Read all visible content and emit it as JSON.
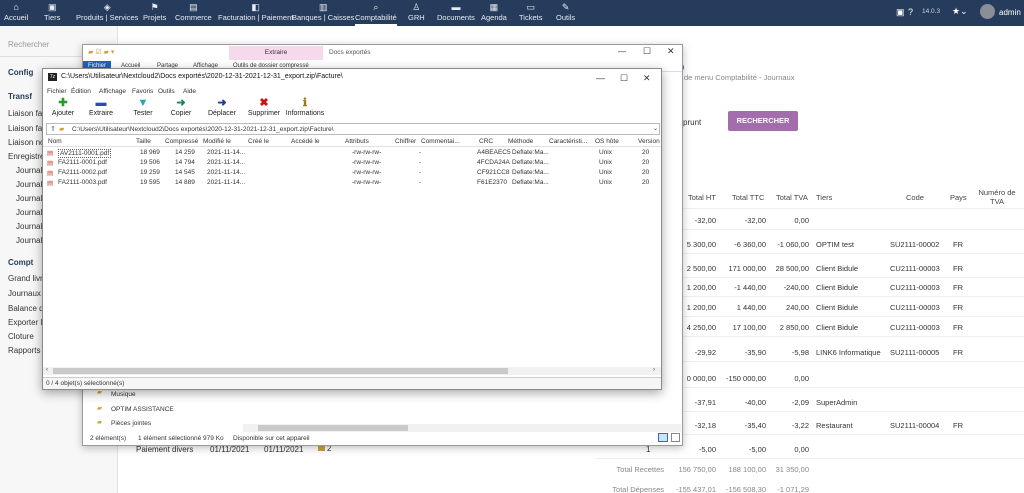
{
  "topbar": {
    "menu": [
      {
        "label": "Accueil",
        "icon": "⌂"
      },
      {
        "label": "Tiers",
        "icon": "▣"
      },
      {
        "label": "Produits | Services",
        "icon": "◈"
      },
      {
        "label": "Projets",
        "icon": "⚑"
      },
      {
        "label": "Commerce",
        "icon": "▤"
      },
      {
        "label": "Facturation | Paiement",
        "icon": "◧"
      },
      {
        "label": "Banques | Caisses",
        "icon": "▥"
      },
      {
        "label": "Comptabilité",
        "icon": "⌕"
      },
      {
        "label": "GRH",
        "icon": "♙"
      },
      {
        "label": "Documents",
        "icon": "▬"
      },
      {
        "label": "Agenda",
        "icon": "▦"
      },
      {
        "label": "Tickets",
        "icon": "▭"
      },
      {
        "label": "Outils",
        "icon": "✎"
      }
    ],
    "version": "14.0.3",
    "user": "admin"
  },
  "left": {
    "search_placeholder": "Rechercher",
    "items": [
      "Config",
      "Transf",
      "Liaison fa",
      "Liaison fa",
      "Liaison no",
      "Enregistre",
      "Journal",
      "Journal",
      "Journal",
      "Journal",
      "Journal",
      "Journal",
      "Compt",
      "Grand livr",
      "Journaux",
      "Balance d",
      "Exporter l",
      "Cloture",
      "Rapports"
    ]
  },
  "main": {
    "breadcrumb": "de menu Comptabilité - Journaux",
    "emprunt_label": "nt emprunt",
    "search_button": "RECHERCHER",
    "headers": {
      "total_ht": "Total HT",
      "total_ttc": "Total TTC",
      "total_tva": "Total TVA",
      "tiers": "Tiers",
      "code": "Code",
      "pays": "Pays",
      "num_tva": "Numéro de TVA"
    },
    "rows": [
      {
        "ht": "-32,00",
        "ttc": "-32,00",
        "tva": "0,00",
        "tiers": "",
        "code": "",
        "pays": ""
      },
      {
        "ht": "5 300,00",
        "ttc": "-6 360,00",
        "tva": "-1 060,00",
        "tiers": "OPTIM test",
        "code": "SU2111-00002",
        "pays": "FR"
      },
      {
        "ht": "2 500,00",
        "ttc": "171 000,00",
        "tva": "28 500,00",
        "tiers": "Client Bidule",
        "code": "CU2111-00003",
        "pays": "FR"
      },
      {
        "ht": "1 200,00",
        "ttc": "-1 440,00",
        "tva": "-240,00",
        "tiers": "Client Bidule",
        "code": "CU2111-00003",
        "pays": "FR"
      },
      {
        "ht": "1 200,00",
        "ttc": "1 440,00",
        "tva": "240,00",
        "tiers": "Client Bidule",
        "code": "CU2111-00003",
        "pays": "FR"
      },
      {
        "ht": "4 250,00",
        "ttc": "17 100,00",
        "tva": "2 850,00",
        "tiers": "Client Bidule",
        "code": "CU2111-00003",
        "pays": "FR"
      },
      {
        "ht": "-29,92",
        "ttc": "-35,90",
        "tva": "-5,98",
        "tiers": "LINK6 Informatique",
        "code": "SU2111-00005",
        "pays": "FR"
      },
      {
        "ht": "0 000,00",
        "ttc": "-150 000,00",
        "tva": "0,00",
        "tiers": "",
        "code": "",
        "pays": ""
      },
      {
        "ht": "-37,91",
        "ttc": "-40,00",
        "tva": "-2,09",
        "tiers": "SuperAdmin",
        "code": "",
        "pays": ""
      },
      {
        "ht": "-32,18",
        "ttc": "-35,40",
        "tva": "-3,22",
        "tiers": "Restaurant",
        "code": "SU2111-00004",
        "pays": "FR"
      },
      {
        "ht": "-5,00",
        "ttc": "-5,00",
        "tva": "0,00",
        "tiers": "",
        "code": "",
        "pays": ""
      }
    ],
    "paiement": {
      "label": "Paiement divers",
      "date1": "01/11/2021",
      "date2": "01/11/2021",
      "count": "2",
      "qty": "1"
    },
    "totals": {
      "recettes_label": "Total Recettes",
      "recettes_ht": "156 750,00",
      "recettes_ttc": "188 100,00",
      "recettes_tva": "31 350,00",
      "depenses_label": "Total Dépenses",
      "depenses_ht": "-155 437,01",
      "depenses_ttc": "-156 508,30",
      "depenses_tva": "-1 071,29"
    }
  },
  "explorer": {
    "ribbon_title": "Extraire",
    "window_title": "Docs exportés",
    "tabs": [
      "Fichier",
      "Accueil",
      "Partage",
      "Affichage",
      "Outils de dossier compressé"
    ],
    "folders": [
      "Musique",
      "OPTIM ASSISTANCE",
      "Pièces jointes"
    ],
    "status": [
      "2 élément(s)",
      "1 élément sélectionné  979 Ko",
      "Disponible sur cet appareil"
    ]
  },
  "zip": {
    "title": "C:\\Users\\Utilisateur\\Nextcloud2\\Docs exportés\\2020-12-31-2021-12-31_export.zip\\Facture\\",
    "menu": [
      "Fichier",
      "Édition",
      "Affichage",
      "Favoris",
      "Outils",
      "Aide"
    ],
    "tools": [
      {
        "label": "Ajouter",
        "icon": "✚",
        "color": "#2a9a2a"
      },
      {
        "label": "Extraire",
        "icon": "▬",
        "color": "#2a4ab5"
      },
      {
        "label": "Tester",
        "icon": "▼",
        "color": "#2aa3b5"
      },
      {
        "label": "Copier",
        "icon": "➜",
        "color": "#1a8a4a"
      },
      {
        "label": "Déplacer",
        "icon": "➜",
        "color": "#1a3a9a"
      },
      {
        "label": "Supprimer",
        "icon": "✖",
        "color": "#cc1111"
      },
      {
        "label": "Informations",
        "icon": "ℹ",
        "color": "#a07a10"
      }
    ],
    "path": "C:\\Users\\Utilisateur\\Nextcloud2\\Docs exportés\\2020-12-31-2021-12-31_export.zip\\Facture\\",
    "columns": [
      "Nom",
      "Taille",
      "Compressé",
      "Modifié le",
      "Créé le",
      "Accédé le",
      "Attributs",
      "Chiffrer",
      "Commentai...",
      "CRC",
      "Méthode",
      "Caractéristi...",
      "OS hôte",
      "Version"
    ],
    "files": [
      {
        "name": "AV2111-0001.pdf",
        "size": "18 969",
        "comp": "14 259",
        "mod": "2021-11-14...",
        "attr": "-rw-rw-rw-",
        "enc": "-",
        "crc": "A4BEAEC5",
        "method": "Deflate:Ma...",
        "os": "Unix",
        "ver": "20"
      },
      {
        "name": "FA2111-0001.pdf",
        "size": "19 506",
        "comp": "14 794",
        "mod": "2021-11-14...",
        "attr": "-rw-rw-rw-",
        "enc": "-",
        "crc": "4FCDA24A",
        "method": "Deflate:Ma...",
        "os": "Unix",
        "ver": "20"
      },
      {
        "name": "FA2111-0002.pdf",
        "size": "19 259",
        "comp": "14 545",
        "mod": "2021-11-14...",
        "attr": "-rw-rw-rw-",
        "enc": "-",
        "crc": "CF921CC8",
        "method": "Deflate:Ma...",
        "os": "Unix",
        "ver": "20"
      },
      {
        "name": "FA2111-0003.pdf",
        "size": "19 595",
        "comp": "14 889",
        "mod": "2021-11-14...",
        "attr": "-rw-rw-rw-",
        "enc": "-",
        "crc": "F61E2370",
        "method": "Deflate:Ma...",
        "os": "Unix",
        "ver": "20"
      }
    ],
    "status": "0 / 4 objet(s) sélectionné(s)"
  }
}
